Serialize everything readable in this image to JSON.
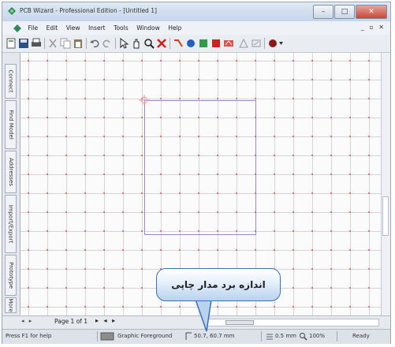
{
  "window": {
    "title": "PCB Wizard - Professional Edition - [Untitled 1]"
  },
  "menu": [
    "File",
    "Edit",
    "View",
    "Insert",
    "Tools",
    "Window",
    "Help"
  ],
  "toolbar_icons": [
    "new-icon",
    "save-icon",
    "print-icon",
    "cut-icon",
    "copy-icon",
    "paste-icon",
    "undo-icon",
    "redo-icon",
    "select-icon",
    "pan-icon",
    "zoom-icon",
    "delete-icon",
    "track-icon",
    "pad-icon",
    "component-icon",
    "fill-icon",
    "text-icon",
    "measure-icon",
    "label-icon",
    "board-icon"
  ],
  "side_tabs": [
    "Connect",
    "Find Model",
    "Addresses",
    "Import/Export",
    "Prototype",
    "More"
  ],
  "bottom": {
    "page_label": "Page 1 of 1"
  },
  "status": {
    "help": "Press F1 for help",
    "layer": "Graphic Foreground",
    "coords": "50.7, 60.7 mm",
    "grid": "0.5 mm",
    "zoom": "100%",
    "state": "Ready"
  },
  "callout": {
    "text": "اندازه برد مدار چاپی"
  },
  "colors": {
    "board_outline": "#9a88c4",
    "grid_dot": "#e07070",
    "callout_border": "#3b6fb8"
  }
}
